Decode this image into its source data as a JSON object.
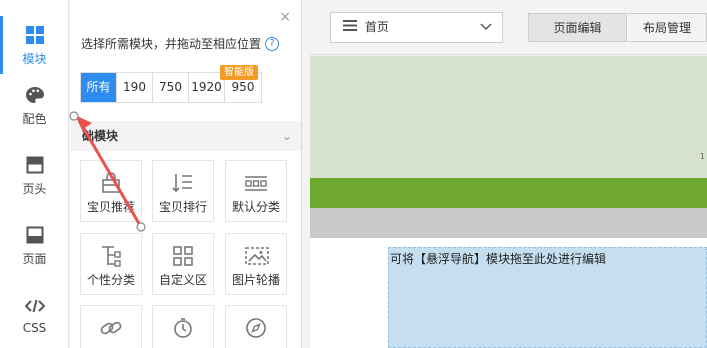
{
  "rail": {
    "items": [
      {
        "label": "模块",
        "icon": "grid-icon",
        "active": true
      },
      {
        "label": "配色",
        "icon": "palette-icon"
      },
      {
        "label": "页头",
        "icon": "header-icon"
      },
      {
        "label": "页面",
        "icon": "page-icon"
      },
      {
        "label": "CSS",
        "icon": "code-icon"
      }
    ]
  },
  "panel": {
    "hint": "选择所需模块，并拖动至相应位置",
    "help": "?",
    "close": "×",
    "widths": [
      "所有",
      "190",
      "750",
      "1920",
      "950"
    ],
    "selected_width": "所有",
    "smart_badge": "智能版",
    "section_title": "础模块",
    "section_chevron": "⌄",
    "tiles": [
      {
        "label": "宝贝推荐",
        "icon": "bag-icon"
      },
      {
        "label": "宝贝排行",
        "icon": "sort-list-icon"
      },
      {
        "label": "默认分类",
        "icon": "category-icon"
      },
      {
        "label": "个性分类",
        "icon": "tree-icon"
      },
      {
        "label": "自定义区",
        "icon": "squares-icon"
      },
      {
        "label": "图片轮播",
        "icon": "image-carousel-icon"
      },
      {
        "label": "",
        "icon": "link-icon"
      },
      {
        "label": "",
        "icon": "timer-icon"
      },
      {
        "label": "",
        "icon": "compass-icon"
      }
    ]
  },
  "editor": {
    "page_select": "首页",
    "tab_edit": "页面编辑",
    "tab_layout": "布局管理",
    "banner_number": "1",
    "drop_text": "可将【悬浮导航】模块拖至此处进行编辑"
  },
  "colors": {
    "accent": "#2d8cf0",
    "badge": "#f59a23",
    "green_bar": "#6fa82f",
    "banner": "#d7e2cd",
    "drop": "#c5dff1",
    "arrow": "#e8534f"
  }
}
